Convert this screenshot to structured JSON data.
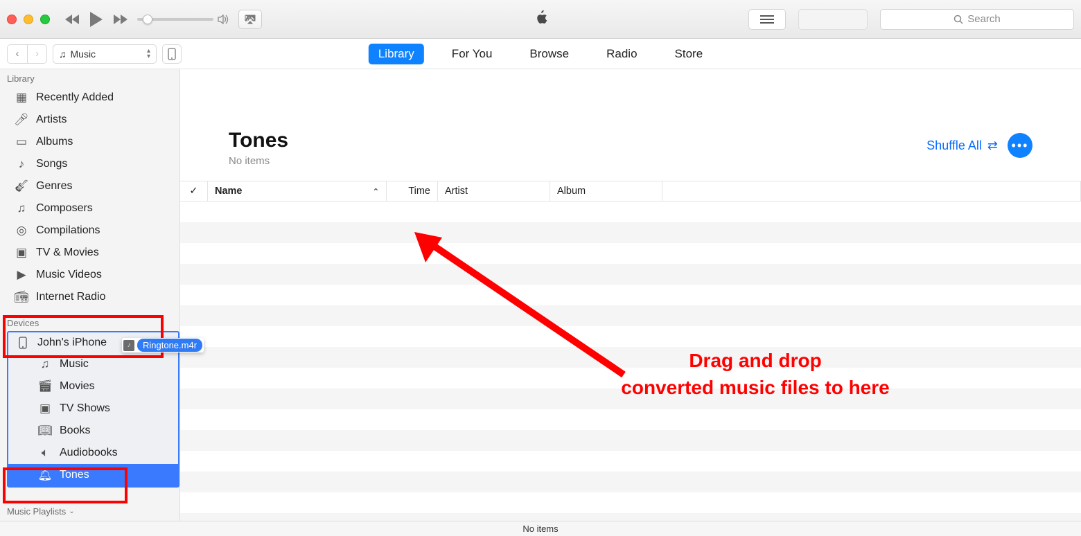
{
  "titlebar": {
    "search_placeholder": "Search"
  },
  "nav": {
    "media_picker": "Music",
    "tabs": [
      "Library",
      "For You",
      "Browse",
      "Radio",
      "Store"
    ],
    "active_tab": "Library"
  },
  "sidebar": {
    "library_header": "Library",
    "library_items": [
      {
        "label": "Recently Added",
        "icon": "clock"
      },
      {
        "label": "Artists",
        "icon": "mic"
      },
      {
        "label": "Albums",
        "icon": "album"
      },
      {
        "label": "Songs",
        "icon": "note"
      },
      {
        "label": "Genres",
        "icon": "guitar"
      },
      {
        "label": "Composers",
        "icon": "composer"
      },
      {
        "label": "Compilations",
        "icon": "disc"
      },
      {
        "label": "TV & Movies",
        "icon": "tv"
      },
      {
        "label": "Music Videos",
        "icon": "video"
      },
      {
        "label": "Internet Radio",
        "icon": "radio"
      }
    ],
    "devices_header": "Devices",
    "device_name": "John's iPhone",
    "device_items": [
      {
        "label": "Music"
      },
      {
        "label": "Movies"
      },
      {
        "label": "TV Shows"
      },
      {
        "label": "Books"
      },
      {
        "label": "Audiobooks"
      },
      {
        "label": "Tones",
        "selected": true
      }
    ],
    "playlists_header": "Music Playlists",
    "drag_file": "Ringtone.m4r"
  },
  "content": {
    "title": "Tones",
    "subtitle": "No items",
    "shuffle_label": "Shuffle All",
    "columns": {
      "check": "✓",
      "name": "Name",
      "time": "Time",
      "artist": "Artist",
      "album": "Album"
    }
  },
  "status": {
    "text": "No items"
  },
  "annotation": {
    "line1": "Drag and drop",
    "line2": "converted music files to here"
  }
}
